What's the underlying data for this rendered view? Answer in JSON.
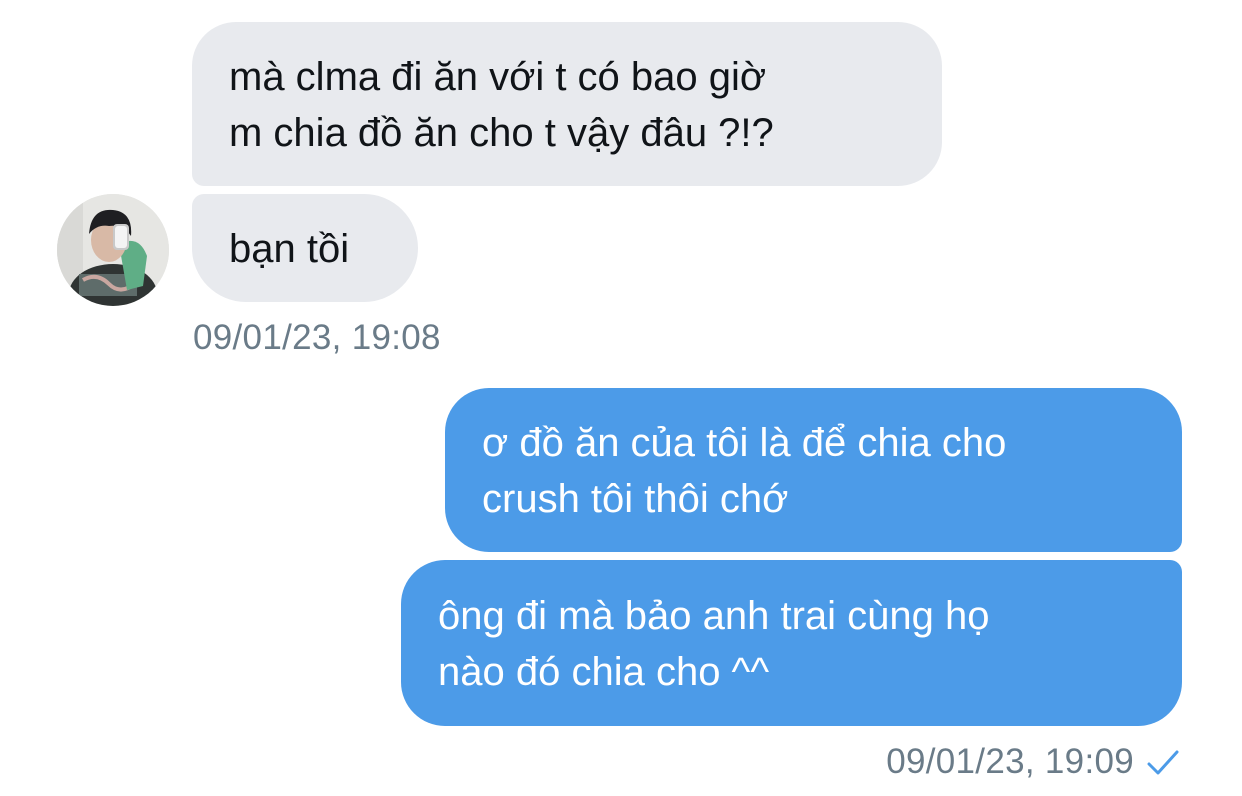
{
  "conversation": {
    "messages": [
      {
        "direction": "received",
        "text": "mà clma đi ăn với t có bao giờ\nm chia đồ ăn cho t vậy đâu ?!?"
      },
      {
        "direction": "received",
        "text": "bạn tồi"
      },
      {
        "direction": "sent",
        "text": "ơ đồ ăn của tôi là để chia cho\ncrush tôi thôi chớ"
      },
      {
        "direction": "sent",
        "text": "ông đi mà bảo anh trai cùng họ\nnào đó chia cho ^^"
      }
    ],
    "received_timestamp": "09/01/23, 19:08",
    "sent_timestamp": "09/01/23, 19:09",
    "read_status_icon": "checkmark-icon"
  },
  "colors": {
    "received_bubble": "#e8eaee",
    "sent_bubble": "#4c9be8",
    "timestamp_text": "#6a7b88",
    "read_check": "#4c9be8"
  }
}
